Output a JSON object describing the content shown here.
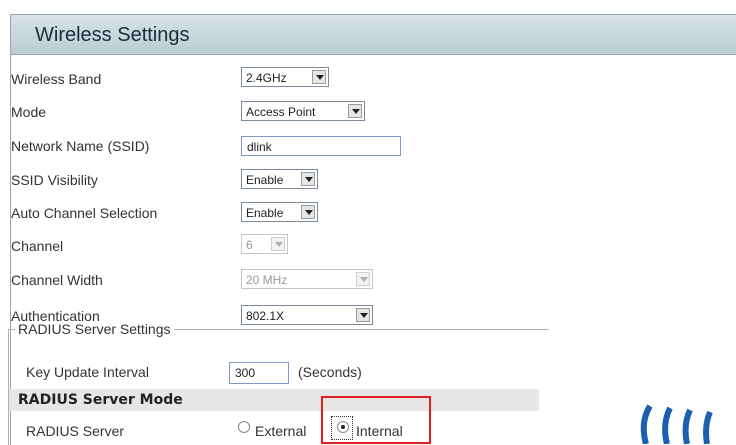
{
  "header": {
    "title": "Wireless Settings"
  },
  "fields": {
    "wireless_band": {
      "label": "Wireless Band",
      "value": "2.4GHz"
    },
    "mode": {
      "label": "Mode",
      "value": "Access Point"
    },
    "ssid": {
      "label": "Network Name (SSID)",
      "value": "dlink"
    },
    "ssid_visibility": {
      "label": "SSID Visibility",
      "value": "Enable"
    },
    "auto_channel": {
      "label": "Auto Channel Selection",
      "value": "Enable"
    },
    "channel": {
      "label": "Channel",
      "value": "6"
    },
    "channel_width": {
      "label": "Channel Width",
      "value": "20 MHz"
    },
    "authentication": {
      "label": "Authentication",
      "value": "802.1X"
    }
  },
  "radius": {
    "group_label": "RADIUS Server Settings",
    "key_update": {
      "label": "Key Update Interval",
      "value": "300",
      "unit": "(Seconds)"
    },
    "mode_header": "RADIUS Server Mode",
    "server": {
      "label": "RADIUS Server",
      "options": [
        "External",
        "Internal"
      ],
      "selected": "Internal"
    }
  },
  "colors": {
    "header_bg": "#c8d5dc",
    "highlight": "#e02020"
  },
  "icons": {
    "wifi_waves": "wifi-waves-icon"
  }
}
